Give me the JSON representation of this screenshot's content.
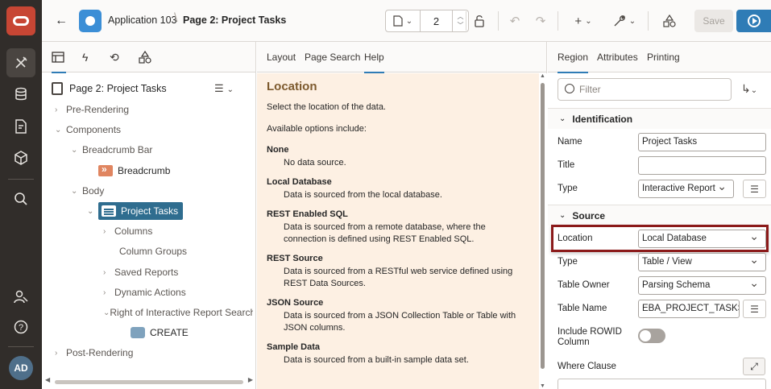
{
  "rail": {
    "icons": [
      "oracle-logo",
      "tools-icon",
      "database-icon",
      "document-edit-icon",
      "package-icon",
      "search-icon",
      "user-settings-icon",
      "help-icon"
    ],
    "avatar": "AD"
  },
  "topbar": {
    "app_name": "Application 103",
    "page_name": "Page 2: Project Tasks",
    "page_number": "2",
    "save_label": "Save",
    "colors": {
      "run": "#2f7cb6",
      "logo": "#c74634",
      "rail": "#312d2a"
    }
  },
  "tree": {
    "tabs": [
      "rendering-tab",
      "dynamic-actions-tab",
      "processing-tab",
      "shared-components-tab"
    ],
    "header": "Page 2: Project Tasks",
    "nodes": [
      {
        "label": "Pre-Rendering",
        "chev": "›"
      },
      {
        "label": "Components",
        "chev": "⌄"
      },
      {
        "label": "Breadcrumb Bar",
        "chev": "⌄"
      },
      {
        "label": "Breadcrumb",
        "chev": ""
      },
      {
        "label": "Body",
        "chev": "⌄"
      },
      {
        "label": "Project Tasks",
        "chev": "⌄"
      },
      {
        "label": "Columns",
        "chev": "›"
      },
      {
        "label": "Column Groups",
        "chev": ""
      },
      {
        "label": "Saved Reports",
        "chev": "›"
      },
      {
        "label": "Dynamic Actions",
        "chev": "›"
      },
      {
        "label": "Right of Interactive Report Search B",
        "chev": "⌄"
      },
      {
        "label": "CREATE",
        "chev": ""
      },
      {
        "label": "Post-Rendering",
        "chev": "›"
      }
    ]
  },
  "help": {
    "tabs": {
      "layout": "Layout",
      "search": "Page Search",
      "help": "Help"
    },
    "title": "Location",
    "intro": "Select the location of the data.",
    "options_intro": "Available options include:",
    "options": [
      {
        "name": "None",
        "desc": "No data source."
      },
      {
        "name": "Local Database",
        "desc": "Data is sourced from the local database."
      },
      {
        "name": "REST Enabled SQL",
        "desc": "Data is sourced from a remote database, where the connection is defined using REST Enabled SQL."
      },
      {
        "name": "REST Source",
        "desc": "Data is sourced from a RESTful web service defined using REST Data Sources."
      },
      {
        "name": "JSON Source",
        "desc": "Data is sourced from a JSON Collection Table or Table with JSON columns."
      },
      {
        "name": "Sample Data",
        "desc": "Data is sourced from a built-in sample data set."
      }
    ]
  },
  "props": {
    "tabs": {
      "region": "Region",
      "attributes": "Attributes",
      "printing": "Printing"
    },
    "filter_placeholder": "Filter",
    "identification": {
      "title": "Identification",
      "name_label": "Name",
      "name_value": "Project Tasks",
      "title_label": "Title",
      "title_value": "",
      "type_label": "Type",
      "type_value": "Interactive Report"
    },
    "source": {
      "title": "Source",
      "location_label": "Location",
      "location_value": "Local Database",
      "type_label": "Type",
      "type_value": "Table / View",
      "owner_label": "Table Owner",
      "owner_value": "Parsing Schema",
      "table_label": "Table Name",
      "table_value": "EBA_PROJECT_TASKS",
      "rowid_label": "Include ROWID Column",
      "where_label": "Where Clause"
    }
  }
}
